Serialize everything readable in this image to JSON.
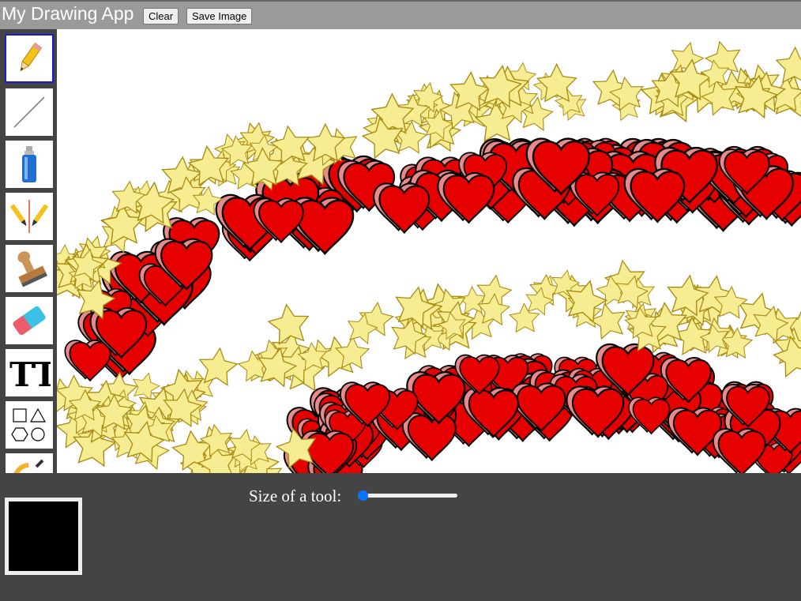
{
  "header": {
    "title": "My Drawing App",
    "clear_label": "Clear",
    "save_label": "Save Image"
  },
  "toolbar": {
    "tools": [
      {
        "name": "pencil",
        "icon": "pencil-icon",
        "active": true
      },
      {
        "name": "line",
        "icon": "line-icon"
      },
      {
        "name": "spray-can",
        "icon": "spray-can-icon"
      },
      {
        "name": "mirror-draw",
        "icon": "mirror-pencils-icon"
      },
      {
        "name": "stamp",
        "icon": "stamp-icon"
      },
      {
        "name": "eraser",
        "icon": "eraser-icon"
      },
      {
        "name": "text",
        "icon": "text-icon"
      },
      {
        "name": "shapes",
        "icon": "shapes-icon"
      },
      {
        "name": "color-picker",
        "icon": "color-wheel-icon"
      }
    ],
    "text_tool_glyph": "TT"
  },
  "footer": {
    "current_color": "#000000",
    "size_label": "Size of a tool:",
    "size_value": 0
  },
  "canvas": {
    "heart_color": "#e60000",
    "heart_shadow_color": "#e88a8a",
    "star_color": "#f6ec92",
    "star_stroke_color": "#a88a10"
  }
}
